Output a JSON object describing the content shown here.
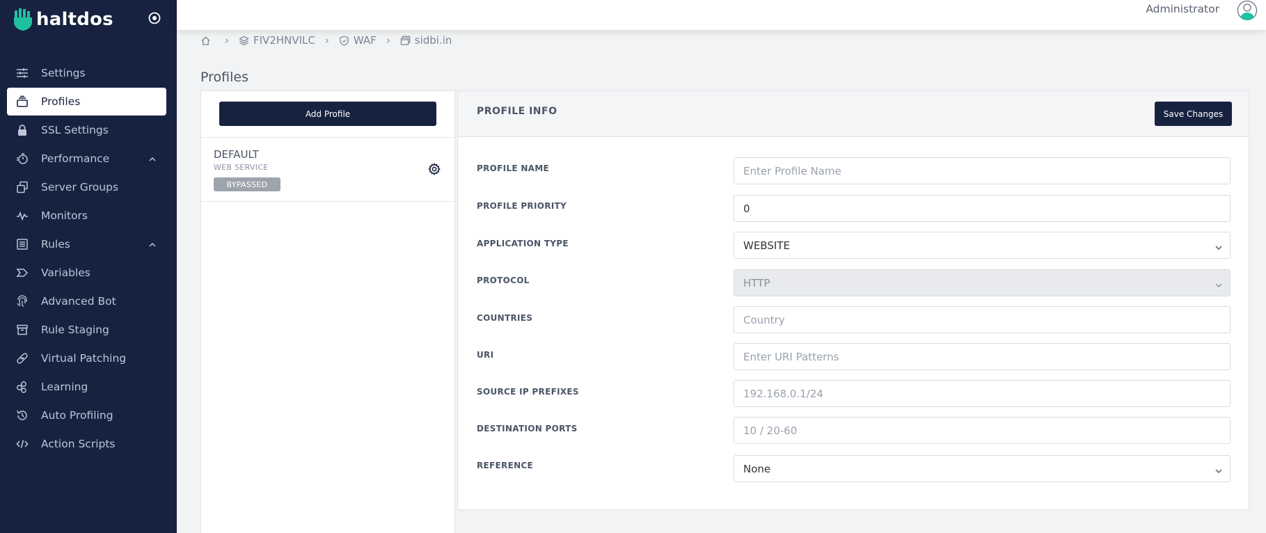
{
  "brand": {
    "name": "haltdos"
  },
  "sidebar": {
    "items": [
      {
        "label": "Settings",
        "icon": "sliders-icon"
      },
      {
        "label": "Profiles",
        "icon": "stack-icon",
        "active": true
      },
      {
        "label": "SSL Settings",
        "icon": "lock-icon"
      },
      {
        "label": "Performance",
        "icon": "stopwatch-icon",
        "expandable": true
      },
      {
        "label": "Server Groups",
        "icon": "server-groups-icon"
      },
      {
        "label": "Monitors",
        "icon": "pulse-icon"
      },
      {
        "label": "Rules",
        "icon": "list-icon",
        "expandable": true
      },
      {
        "label": "Variables",
        "icon": "tag-icon"
      },
      {
        "label": "Advanced Bot",
        "icon": "fingerprint-icon"
      },
      {
        "label": "Rule Staging",
        "icon": "archive-icon"
      },
      {
        "label": "Virtual Patching",
        "icon": "bandage-icon"
      },
      {
        "label": "Learning",
        "icon": "learning-icon"
      },
      {
        "label": "Auto Profiling",
        "icon": "history-icon"
      },
      {
        "label": "Action Scripts",
        "icon": "code-icon"
      }
    ]
  },
  "topbar": {
    "user": "Administrator"
  },
  "breadcrumb": {
    "items": [
      {
        "label": "",
        "icon": "home-icon"
      },
      {
        "label": "FIV2HNVILC",
        "icon": "layers-icon"
      },
      {
        "label": "WAF",
        "icon": "shield-icon"
      },
      {
        "label": "sidbi.in",
        "icon": "window-icon"
      }
    ]
  },
  "page": {
    "title": "Profiles"
  },
  "profile_list": {
    "add_label": "Add Profile",
    "items": [
      {
        "name": "DEFAULT",
        "type": "WEB SERVICE",
        "status": "BYPASSED"
      }
    ]
  },
  "profile_info": {
    "title": "PROFILE INFO",
    "save_label": "Save Changes",
    "fields": {
      "profile_name": {
        "label": "PROFILE NAME",
        "value": "",
        "placeholder": "Enter Profile Name"
      },
      "profile_priority": {
        "label": "PROFILE PRIORITY",
        "value": "0",
        "placeholder": ""
      },
      "application_type": {
        "label": "APPLICATION TYPE",
        "value": "WEBSITE"
      },
      "protocol": {
        "label": "PROTOCOL",
        "value": "HTTP",
        "disabled": true
      },
      "countries": {
        "label": "COUNTRIES",
        "value": "",
        "placeholder": "Country"
      },
      "uri": {
        "label": "URI",
        "value": "",
        "placeholder": "Enter URI Patterns"
      },
      "source_ip": {
        "label": "SOURCE IP PREFIXES",
        "value": "",
        "placeholder": "192.168.0.1/24"
      },
      "destination_ports": {
        "label": "DESTINATION PORTS",
        "value": "",
        "placeholder": "10 / 20-60"
      },
      "reference": {
        "label": "REFERENCE",
        "value": "None"
      }
    }
  },
  "colors": {
    "sidebar_bg": "#172240",
    "brand_accent": "#1fc2a0",
    "button_bg": "#172240",
    "badge_bg": "#9ea4ae",
    "page_bg": "#f1f3f4"
  }
}
